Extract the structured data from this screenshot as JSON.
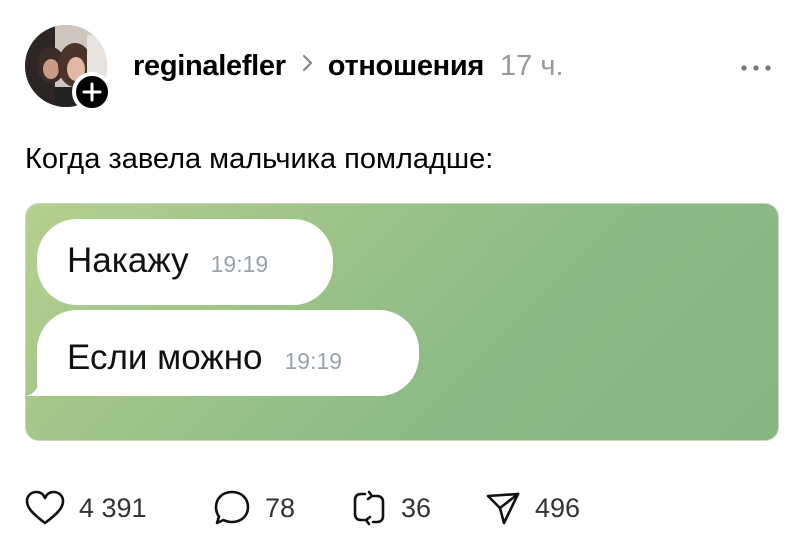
{
  "post": {
    "username": "reginalefler",
    "topic": "отношения",
    "time": "17 ч.",
    "caption": "Когда завела мальчика помладше:"
  },
  "chat": {
    "messages": [
      {
        "text": "Накажу",
        "time": "19:19"
      },
      {
        "text": "Если можно",
        "time": "19:19"
      }
    ]
  },
  "actions": {
    "likes": "4 391",
    "comments": "78",
    "reposts": "36",
    "shares": "496"
  },
  "icons": [
    "plus-icon",
    "chevron-right-icon",
    "more-icon",
    "heart-icon",
    "comment-icon",
    "repost-icon",
    "share-icon"
  ]
}
